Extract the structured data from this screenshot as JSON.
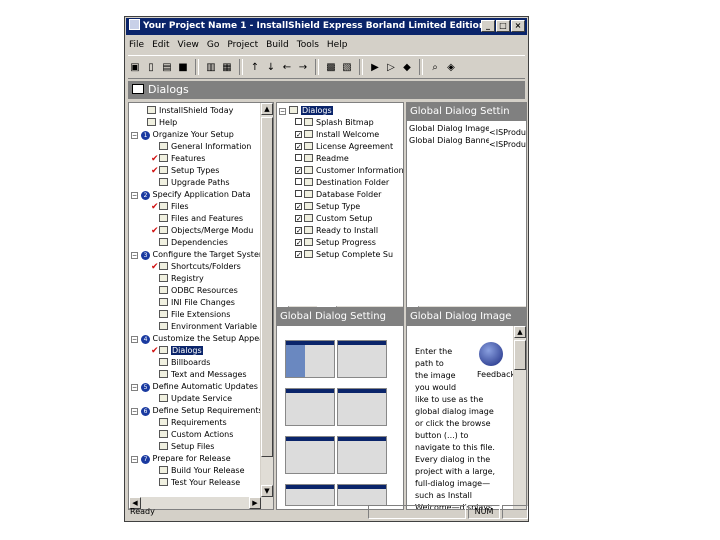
{
  "window": {
    "title": "Your Project Name 1 - InstallShield Express Borland Limited Edition"
  },
  "menu": [
    "File",
    "Edit",
    "View",
    "Go",
    "Project",
    "Build",
    "Tools",
    "Help"
  ],
  "view_header": "Dialogs",
  "nav_tree": [
    {
      "label": "InstallShield Today",
      "indent": 1
    },
    {
      "label": "Help",
      "indent": 1
    },
    {
      "label": "Organize Your Setup",
      "indent": 0,
      "num": "1"
    },
    {
      "label": "General Information",
      "indent": 2
    },
    {
      "label": "Features",
      "indent": 2,
      "check": true
    },
    {
      "label": "Setup Types",
      "indent": 2,
      "check": true
    },
    {
      "label": "Upgrade Paths",
      "indent": 2
    },
    {
      "label": "Specify Application Data",
      "indent": 0,
      "num": "2"
    },
    {
      "label": "Files",
      "indent": 2,
      "check": true
    },
    {
      "label": "Files and Features",
      "indent": 2
    },
    {
      "label": "Objects/Merge Modu",
      "indent": 2,
      "check": true
    },
    {
      "label": "Dependencies",
      "indent": 2
    },
    {
      "label": "Configure the Target System",
      "indent": 0,
      "num": "3"
    },
    {
      "label": "Shortcuts/Folders",
      "indent": 2,
      "check": true
    },
    {
      "label": "Registry",
      "indent": 2
    },
    {
      "label": "ODBC Resources",
      "indent": 2
    },
    {
      "label": "INI File Changes",
      "indent": 2
    },
    {
      "label": "File Extensions",
      "indent": 2
    },
    {
      "label": "Environment Variable",
      "indent": 2
    },
    {
      "label": "Customize the Setup Appear",
      "indent": 0,
      "num": "4"
    },
    {
      "label": "Dialogs",
      "indent": 2,
      "check": true,
      "selected": true
    },
    {
      "label": "Billboards",
      "indent": 2
    },
    {
      "label": "Text and Messages",
      "indent": 2
    },
    {
      "label": "Define Automatic Updates",
      "indent": 0,
      "num": "5"
    },
    {
      "label": "Update Service",
      "indent": 2
    },
    {
      "label": "Define Setup Requirements",
      "indent": 0,
      "num": "6"
    },
    {
      "label": "Requirements",
      "indent": 2
    },
    {
      "label": "Custom Actions",
      "indent": 2
    },
    {
      "label": "Setup Files",
      "indent": 2
    },
    {
      "label": "Prepare for Release",
      "indent": 0,
      "num": "7"
    },
    {
      "label": "Build Your Release",
      "indent": 2
    },
    {
      "label": "Test Your Release",
      "indent": 2
    }
  ],
  "dialogs_tree": {
    "root": "Dialogs",
    "items": [
      {
        "label": "Splash Bitmap",
        "checked": false
      },
      {
        "label": "Install Welcome",
        "checked": true
      },
      {
        "label": "License Agreement",
        "checked": true
      },
      {
        "label": "Readme",
        "checked": false
      },
      {
        "label": "Customer Information",
        "checked": true
      },
      {
        "label": "Destination Folder",
        "checked": false
      },
      {
        "label": "Database Folder",
        "checked": false
      },
      {
        "label": "Setup Type",
        "checked": true
      },
      {
        "label": "Custom Setup",
        "checked": true
      },
      {
        "label": "Ready to Install",
        "checked": true
      },
      {
        "label": "Setup Progress",
        "checked": true
      },
      {
        "label": "Setup Complete Su",
        "checked": true
      }
    ]
  },
  "gds": {
    "header": "Global Dialog Settin",
    "rows": [
      {
        "name": "Global Dialog Image",
        "value": "<ISProdu"
      },
      {
        "name": "Global Dialog Banner",
        "value": "<ISProdu"
      }
    ]
  },
  "thumbs": {
    "header": "Global Dialog Setting"
  },
  "gdi": {
    "header": "Global Dialog Image",
    "feedback": "Feedback",
    "help_lines": [
      "Enter the",
      "path to",
      "the image",
      "you would",
      "like to use as the",
      "global dialog image",
      "or click the browse",
      "button (...) to",
      "navigate to this file.",
      "Every dialog in the",
      "project with a large,",
      "full-dialog image—",
      "such as Install",
      "Welcome—displays"
    ]
  },
  "status": {
    "text": "Ready",
    "num": "NUM"
  },
  "colors": {
    "title_bar": "#0a246a",
    "window_face": "#d4d0c8",
    "pane_header": "#808080",
    "check": "#d01010"
  }
}
